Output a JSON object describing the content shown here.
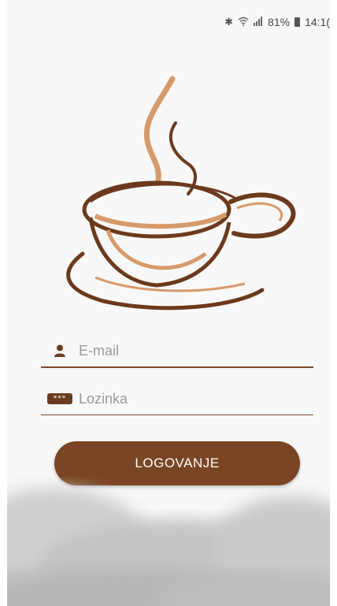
{
  "status_bar": {
    "bluetooth_icon": "bluetooth-icon",
    "wifi_icon": "wifi-icon",
    "signal_icon": "signal-icon",
    "battery_text": "81%",
    "battery_icon": "battery-icon",
    "time": "14:1("
  },
  "logo": {
    "icon": "coffee-cup-logo",
    "colors": {
      "dark": "#6b3a1c",
      "light": "#d69a6b"
    }
  },
  "form": {
    "email": {
      "icon": "user-icon",
      "placeholder": "E-mail",
      "value": ""
    },
    "password": {
      "icon": "password-icon",
      "icon_text": "***",
      "placeholder": "Lozinka",
      "value": ""
    },
    "login_button_label": "LOGOVANJE"
  },
  "colors": {
    "accent": "#7a4524",
    "underline": "#7a4b2a",
    "background": "#f8f8f8"
  }
}
